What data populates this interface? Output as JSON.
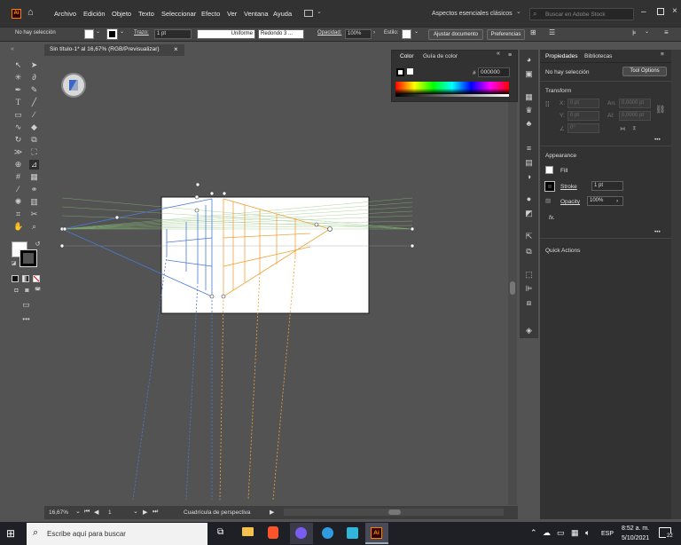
{
  "app": {
    "logo": "Ai",
    "menus": [
      "Archivo",
      "Edición",
      "Objeto",
      "Texto",
      "Seleccionar",
      "Efecto",
      "Ver",
      "Ventana",
      "Ayuda"
    ],
    "workspace": "Aspectos esenciales clásicos",
    "search_placeholder": "Buscar en Adobe Stock"
  },
  "control": {
    "selection": "No hay selección",
    "stroke_label": "Trazo:",
    "stroke_value": "1 pt",
    "profile": "Uniforme",
    "brush": "Redondo 3 ...",
    "opacity_label": "Opacidad:",
    "opacity_value": "100%",
    "style_label": "Estilo:",
    "doc_setup": "Ajustar documento",
    "prefs": "Preferencias"
  },
  "document": {
    "tab_title": "Sin título-1* al 16,67% (RGB/Previsualizar)",
    "close": "×"
  },
  "status": {
    "zoom": "16,67%",
    "artboard": "1",
    "tool_name": "Cuadrícula de perspectiva"
  },
  "color_panel": {
    "tab_color": "Color",
    "tab_guide": "Guía de color",
    "hash": "#",
    "hex": "000000"
  },
  "properties": {
    "tab_props": "Propiedades",
    "tab_libs": "Bibliotecas",
    "no_selection": "No hay selección",
    "tool_options": "Tool Options",
    "transform": "Transform",
    "x_label": "X:",
    "x_value": "0 pt",
    "y_label": "Y:",
    "y_value": "0 pt",
    "w_label": "An:",
    "w_value": "0,0000 pt",
    "h_label": "Al:",
    "h_value": "0,0000 pt",
    "angle_value": "0°",
    "appearance": "Appearance",
    "fill": "Fill",
    "stroke": "Stroke",
    "stroke_value": "1 pt",
    "opacity": "Opacity",
    "opacity_value": "100%",
    "fx": "fx.",
    "quick_actions": "Quick Actions",
    "more": "•••"
  },
  "taskbar": {
    "search": "Escribe aquí para buscar",
    "lang": "ESP",
    "time": "8:52 a. m.",
    "date": "5/10/2021",
    "notif": "22"
  },
  "colors": {
    "menubar": "#323232",
    "canvas": "#535353",
    "artboard": "#ffffff",
    "blue_grid": "#4a7ad6",
    "orange_grid": "#f0a23c",
    "green_grid": "#7cc46c",
    "ai_orange": "#ff7c00"
  }
}
